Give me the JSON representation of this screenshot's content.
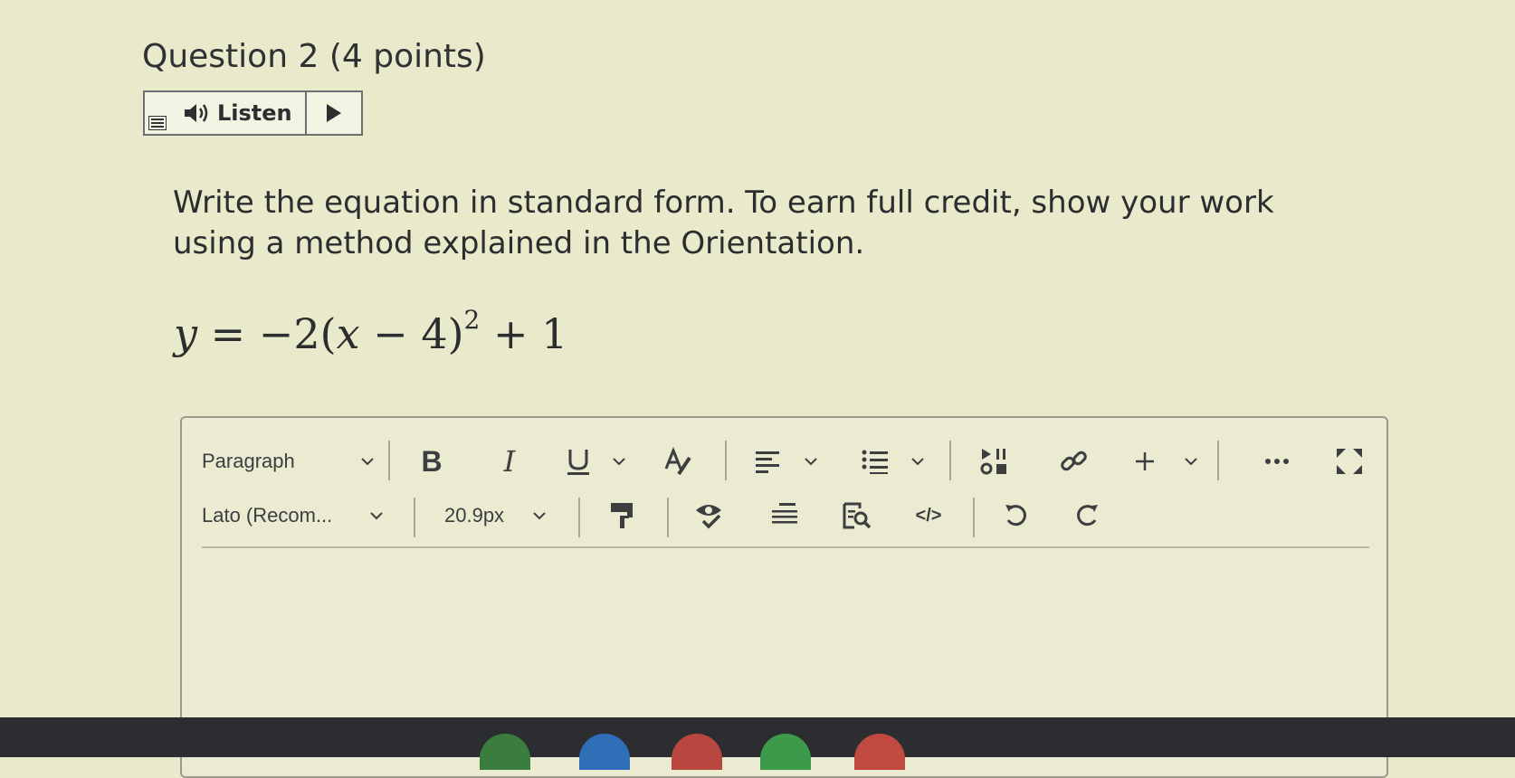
{
  "question": {
    "title": "Question 2",
    "points": "(4 points)"
  },
  "listen": {
    "label": "Listen"
  },
  "prompt": {
    "line1": "Write the equation in standard form.  To earn full credit, show your work",
    "line2": "using a method explained in the Orientation."
  },
  "equation": {
    "lhs": "y",
    "eq": "=",
    "coef": "−2(",
    "var": "x",
    "minus": "−",
    "four": "4)",
    "exp": "2",
    "tail": "+ 1"
  },
  "toolbar": {
    "block_format": "Paragraph",
    "bold": "B",
    "italic": "I",
    "font_family": "Lato (Recom...",
    "font_size": "20.9px",
    "html": "</>"
  },
  "colors": {
    "background": "#e9eacb",
    "border": "#6d6f70",
    "text": "#2b2d2f",
    "dock": "#2b2d31"
  }
}
